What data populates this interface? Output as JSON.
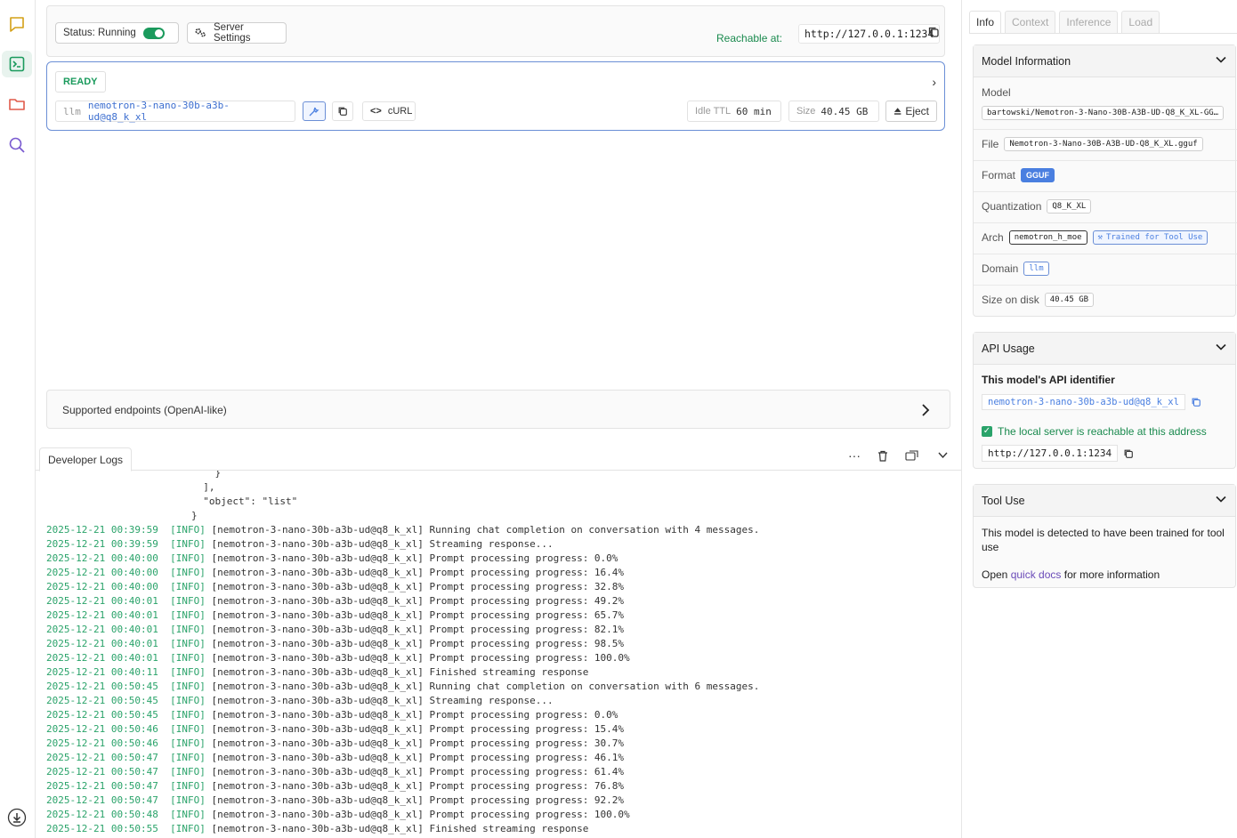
{
  "rail": {
    "items": [
      "chat-icon",
      "developer-terminal-icon",
      "folder-icon",
      "search-icon"
    ],
    "bottom": "download-icon"
  },
  "toolbar": {
    "status_label": "Status: Running",
    "settings_label": "Server Settings",
    "reachable_label": "Reachable at:",
    "reachable_url": "http://127.0.0.1:1234"
  },
  "model_card": {
    "status": "READY",
    "type_label": "llm",
    "model_id": "nemotron-3-nano-30b-a3b-ud@q8_k_xl",
    "curl_label": "cURL",
    "idle_ttl_label": "Idle TTL",
    "idle_ttl_value": "60 min",
    "size_label": "Size",
    "size_value": "40.45 GB",
    "eject_label": "Eject"
  },
  "endpoints": {
    "label": "Supported endpoints (OpenAI-like)"
  },
  "devlogs": {
    "tab_label": "Developer Logs",
    "json_tail": "            }\n          ],\n          \"object\": \"list\"\n        }",
    "lines": [
      {
        "ts": "2025-12-21 00:39:59",
        "lvl": "[INFO]",
        "msg": "[nemotron-3-nano-30b-a3b-ud@q8_k_xl] Running chat completion on conversation with 4 messages."
      },
      {
        "ts": "2025-12-21 00:39:59",
        "lvl": "[INFO]",
        "msg": "[nemotron-3-nano-30b-a3b-ud@q8_k_xl] Streaming response..."
      },
      {
        "ts": "2025-12-21 00:40:00",
        "lvl": "[INFO]",
        "msg": "[nemotron-3-nano-30b-a3b-ud@q8_k_xl] Prompt processing progress: 0.0%"
      },
      {
        "ts": "2025-12-21 00:40:00",
        "lvl": "[INFO]",
        "msg": "[nemotron-3-nano-30b-a3b-ud@q8_k_xl] Prompt processing progress: 16.4%"
      },
      {
        "ts": "2025-12-21 00:40:00",
        "lvl": "[INFO]",
        "msg": "[nemotron-3-nano-30b-a3b-ud@q8_k_xl] Prompt processing progress: 32.8%"
      },
      {
        "ts": "2025-12-21 00:40:01",
        "lvl": "[INFO]",
        "msg": "[nemotron-3-nano-30b-a3b-ud@q8_k_xl] Prompt processing progress: 49.2%"
      },
      {
        "ts": "2025-12-21 00:40:01",
        "lvl": "[INFO]",
        "msg": "[nemotron-3-nano-30b-a3b-ud@q8_k_xl] Prompt processing progress: 65.7%"
      },
      {
        "ts": "2025-12-21 00:40:01",
        "lvl": "[INFO]",
        "msg": "[nemotron-3-nano-30b-a3b-ud@q8_k_xl] Prompt processing progress: 82.1%"
      },
      {
        "ts": "2025-12-21 00:40:01",
        "lvl": "[INFO]",
        "msg": "[nemotron-3-nano-30b-a3b-ud@q8_k_xl] Prompt processing progress: 98.5%"
      },
      {
        "ts": "2025-12-21 00:40:01",
        "lvl": "[INFO]",
        "msg": "[nemotron-3-nano-30b-a3b-ud@q8_k_xl] Prompt processing progress: 100.0%"
      },
      {
        "ts": "2025-12-21 00:40:11",
        "lvl": "[INFO]",
        "msg": "[nemotron-3-nano-30b-a3b-ud@q8_k_xl] Finished streaming response"
      },
      {
        "ts": "2025-12-21 00:50:45",
        "lvl": "[INFO]",
        "msg": "[nemotron-3-nano-30b-a3b-ud@q8_k_xl] Running chat completion on conversation with 6 messages."
      },
      {
        "ts": "2025-12-21 00:50:45",
        "lvl": "[INFO]",
        "msg": "[nemotron-3-nano-30b-a3b-ud@q8_k_xl] Streaming response..."
      },
      {
        "ts": "2025-12-21 00:50:45",
        "lvl": "[INFO]",
        "msg": "[nemotron-3-nano-30b-a3b-ud@q8_k_xl] Prompt processing progress: 0.0%"
      },
      {
        "ts": "2025-12-21 00:50:46",
        "lvl": "[INFO]",
        "msg": "[nemotron-3-nano-30b-a3b-ud@q8_k_xl] Prompt processing progress: 15.4%"
      },
      {
        "ts": "2025-12-21 00:50:46",
        "lvl": "[INFO]",
        "msg": "[nemotron-3-nano-30b-a3b-ud@q8_k_xl] Prompt processing progress: 30.7%"
      },
      {
        "ts": "2025-12-21 00:50:47",
        "lvl": "[INFO]",
        "msg": "[nemotron-3-nano-30b-a3b-ud@q8_k_xl] Prompt processing progress: 46.1%"
      },
      {
        "ts": "2025-12-21 00:50:47",
        "lvl": "[INFO]",
        "msg": "[nemotron-3-nano-30b-a3b-ud@q8_k_xl] Prompt processing progress: 61.4%"
      },
      {
        "ts": "2025-12-21 00:50:47",
        "lvl": "[INFO]",
        "msg": "[nemotron-3-nano-30b-a3b-ud@q8_k_xl] Prompt processing progress: 76.8%"
      },
      {
        "ts": "2025-12-21 00:50:47",
        "lvl": "[INFO]",
        "msg": "[nemotron-3-nano-30b-a3b-ud@q8_k_xl] Prompt processing progress: 92.2%"
      },
      {
        "ts": "2025-12-21 00:50:48",
        "lvl": "[INFO]",
        "msg": "[nemotron-3-nano-30b-a3b-ud@q8_k_xl] Prompt processing progress: 100.0%"
      },
      {
        "ts": "2025-12-21 00:50:55",
        "lvl": "[INFO]",
        "msg": "[nemotron-3-nano-30b-a3b-ud@q8_k_xl] Finished streaming response"
      }
    ]
  },
  "right_panel": {
    "tabs": [
      "Info",
      "Context",
      "Inference",
      "Load"
    ],
    "model_info": {
      "title": "Model Information",
      "model_label": "Model",
      "model_value": "bartowski/Nemotron-3-Nano-30B-A3B-UD-Q8_K_XL-GG…",
      "file_label": "File",
      "file_value": "Nemotron-3-Nano-30B-A3B-UD-Q8_K_XL.gguf",
      "format_label": "Format",
      "format_value": "GGUF",
      "quant_label": "Quantization",
      "quant_value": "Q8_K_XL",
      "arch_label": "Arch",
      "arch_value": "nemotron_h_moe",
      "tool_badge": "Trained for Tool Use",
      "domain_label": "Domain",
      "domain_value": "llm",
      "size_label": "Size on disk",
      "size_value": "40.45 GB"
    },
    "api_usage": {
      "title": "API Usage",
      "identifier_heading": "This model's API identifier",
      "identifier": "nemotron-3-nano-30b-a3b-ud@q8_k_xl",
      "reachable_note": "The local server is reachable at this address",
      "url": "http://127.0.0.1:1234"
    },
    "tool_use": {
      "title": "Tool Use",
      "description": "This model is detected to have been trained for tool use",
      "open_text": "Open",
      "link_text": "quick docs",
      "after_link": "for more information"
    }
  },
  "colors": {
    "accent_green": "#1a9a5c",
    "accent_blue": "#3d6fd0",
    "link_purple": "#6a4bb8"
  }
}
